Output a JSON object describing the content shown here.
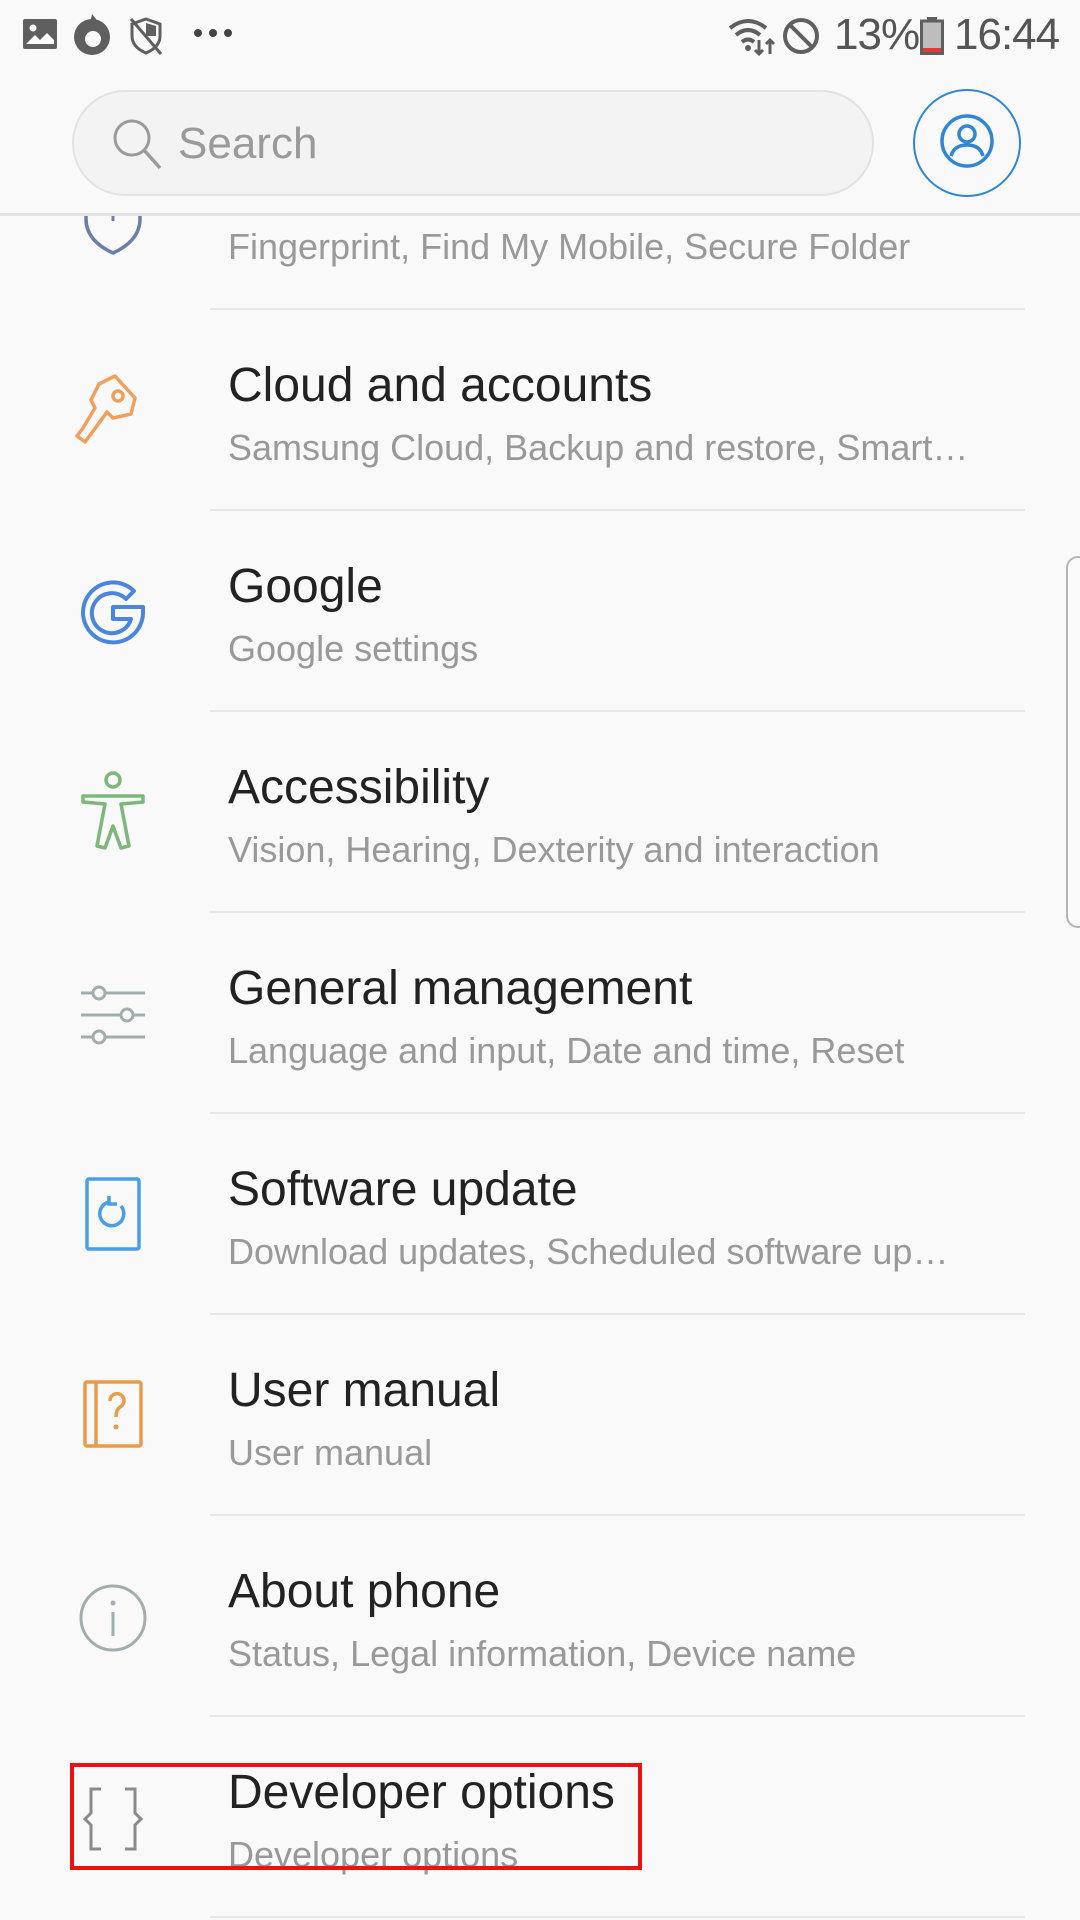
{
  "status_bar": {
    "left_icons": [
      "gallery-icon",
      "firefox-icon",
      "shield-off-icon",
      "more-notifications-icon"
    ],
    "right_icons": [
      "wifi-data-icon",
      "blocked-icon",
      "battery-low-icon"
    ],
    "battery_percent": "13%",
    "time": "16:44",
    "battery_color": "#e53935"
  },
  "header": {
    "search_placeholder": "Search",
    "search_value": "",
    "account_icon": "account-icon",
    "accent": "#2f86d6"
  },
  "settings": {
    "items": [
      {
        "key": "lock-screen-security",
        "title": "",
        "subtitle": "Fingerprint, Find My Mobile, Secure Folder",
        "icon": "shield-icon",
        "color": "#6b7ea8"
      },
      {
        "key": "cloud-and-accounts",
        "title": "Cloud and accounts",
        "subtitle": "Samsung Cloud, Backup and restore, Smart…",
        "icon": "key-icon",
        "color": "#f0a05c"
      },
      {
        "key": "google",
        "title": "Google",
        "subtitle": "Google settings",
        "icon": "google-icon",
        "color": "#4a86e0"
      },
      {
        "key": "accessibility",
        "title": "Accessibility",
        "subtitle": "Vision, Hearing, Dexterity and interaction",
        "icon": "accessibility-icon",
        "color": "#7cb87a"
      },
      {
        "key": "general-management",
        "title": "General management",
        "subtitle": "Language and input, Date and time, Reset",
        "icon": "sliders-icon",
        "color": "#a3adad"
      },
      {
        "key": "software-update",
        "title": "Software update",
        "subtitle": "Download updates, Scheduled software up…",
        "icon": "software-update-icon",
        "color": "#4a9ee8"
      },
      {
        "key": "user-manual",
        "title": "User manual",
        "subtitle": "User manual",
        "icon": "user-manual-icon",
        "color": "#e89b4a"
      },
      {
        "key": "about-phone",
        "title": "About phone",
        "subtitle": "Status, Legal information, Device name",
        "icon": "info-icon",
        "color": "#a3adad"
      },
      {
        "key": "developer-options",
        "title": "Developer options",
        "subtitle": "Developer options",
        "icon": "braces-icon",
        "color": "#8a8a8a"
      }
    ]
  },
  "annotation": {
    "highlighted_item": "developer-options",
    "color": "#ee1111"
  }
}
